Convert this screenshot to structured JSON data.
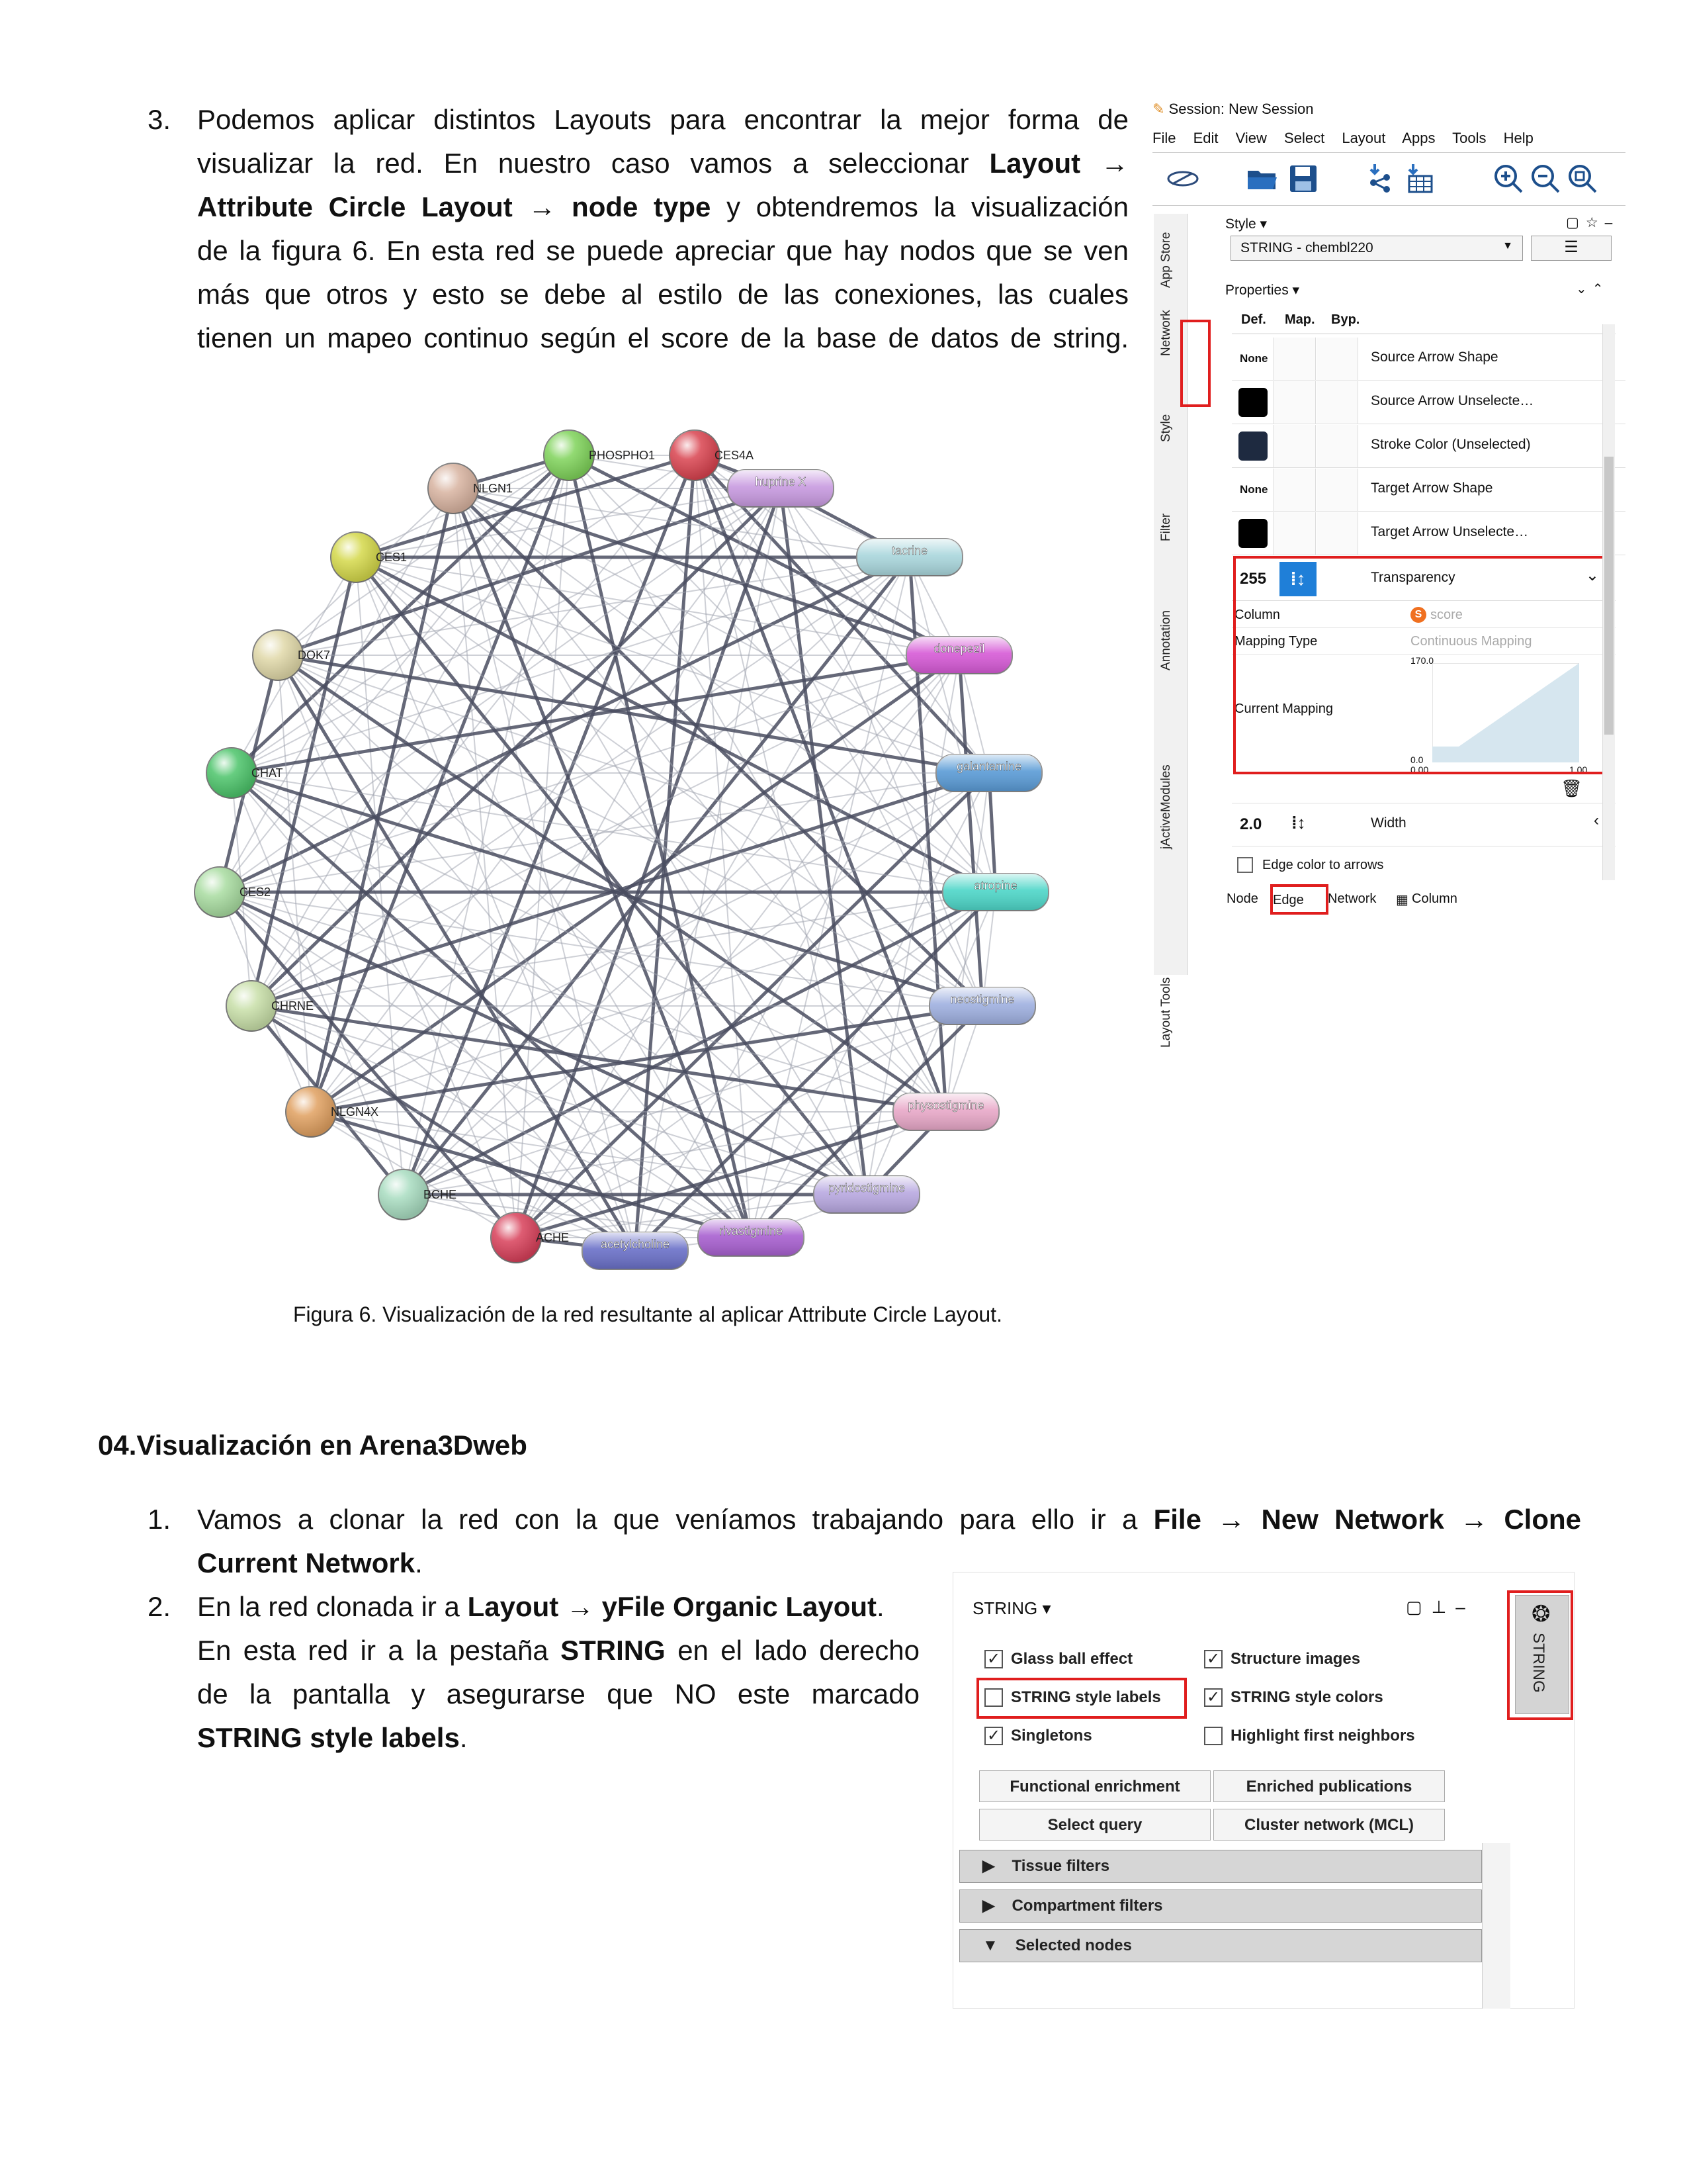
{
  "section3": {
    "number": "3.",
    "lines": [
      "Podemos aplicar distintos Layouts para encontrar la mejor forma de",
      "visualizar la red. En nuestro caso vamos a seleccionar",
      "Attribute Circle Layout",
      "node type",
      "y obtendremos la visualización",
      "de la figura 6. En esta red se puede apreciar que hay nodos que se ven",
      "más que otros y esto se debe al estilo de las conexiones, las cuales",
      "tienen un mapeo continuo según el score de la base de datos de string."
    ],
    "bold_layout": "Layout",
    "arrow": "→"
  },
  "figure": {
    "caption": "Figura 6. Visualización de la red resultante al aplicar Attribute Circle Layout.",
    "nodes": [
      {
        "label": "PHOSPHO1",
        "color": "#7fd35a",
        "shape": "ball"
      },
      {
        "label": "CES4A",
        "color": "#d9434f",
        "shape": "ball"
      },
      {
        "label": "huprine X",
        "color": "#c89ae0",
        "shape": "pill"
      },
      {
        "label": "NLGN1",
        "color": "#d8b3a0",
        "shape": "ball"
      },
      {
        "label": "tacrine",
        "color": "#a9d6dc",
        "shape": "pill"
      },
      {
        "label": "CES1",
        "color": "#d4d84a",
        "shape": "ball"
      },
      {
        "label": "donepezil",
        "color": "#d65ad6",
        "shape": "pill"
      },
      {
        "label": "DOK7",
        "color": "#e0d8a8",
        "shape": "ball"
      },
      {
        "label": "galantamine",
        "color": "#5a9bd6",
        "shape": "pill"
      },
      {
        "label": "CHAT",
        "color": "#4cc46a",
        "shape": "ball"
      },
      {
        "label": "atropine",
        "color": "#4dd6c8",
        "shape": "pill"
      },
      {
        "label": "CES2",
        "color": "#a8dca0",
        "shape": "ball"
      },
      {
        "label": "neostigmine",
        "color": "#9fb0e0",
        "shape": "pill"
      },
      {
        "label": "CHRNE",
        "color": "#c8dfa8",
        "shape": "ball"
      },
      {
        "label": "physostigmine",
        "color": "#e8a8c8",
        "shape": "pill"
      },
      {
        "label": "NLGN4X",
        "color": "#e0a060",
        "shape": "ball"
      },
      {
        "label": "pyridostigmine",
        "color": "#b8a8e0",
        "shape": "pill"
      },
      {
        "label": "BCHE",
        "color": "#a8dcc0",
        "shape": "ball"
      },
      {
        "label": "rivastigmine",
        "color": "#a860d0",
        "shape": "pill"
      },
      {
        "label": "ACHE",
        "color": "#d8405a",
        "shape": "ball"
      },
      {
        "label": "acetylcholine",
        "color": "#6a70c8",
        "shape": "pill"
      }
    ]
  },
  "cytoscape": {
    "session_title": "Session: New Session",
    "menu": [
      "File",
      "Edit",
      "View",
      "Select",
      "Layout",
      "Apps",
      "Tools",
      "Help"
    ],
    "side_tabs": [
      "App Store",
      "Network",
      "Style",
      "Filter",
      "Annotation",
      "jActiveModules",
      "Layout Tools"
    ],
    "style_label": "Style",
    "style_value": "STRING - chembl220",
    "properties_label": "Properties",
    "col_headers": [
      "Def.",
      "Map.",
      "Byp."
    ],
    "rows": [
      {
        "def": "None",
        "label": "Source Arrow Shape"
      },
      {
        "def": "",
        "label": "Source Arrow Unselecte…",
        "swatch": "#000000"
      },
      {
        "def": "",
        "label": "Stroke Color (Unselected)",
        "swatch": "#1e2a40"
      },
      {
        "def": "None",
        "label": "Target Arrow Shape"
      },
      {
        "def": "",
        "label": "Target Arrow Unselecte…",
        "swatch": "#000000"
      }
    ],
    "transparency": {
      "def": "255",
      "label": "Transparency",
      "column_label": "Column",
      "column_value": "score",
      "mapping_type_label": "Mapping Type",
      "mapping_type_value": "Continuous Mapping",
      "current_mapping_label": "Current Mapping",
      "y_max": "170.0",
      "y_min": "0.0",
      "x_min": "0.00",
      "x_max": "1.00"
    },
    "width_row": {
      "def": "2.0",
      "label": "Width"
    },
    "edge_color_label": "Edge color to arrows",
    "bottom_tabs": [
      "Node",
      "Edge",
      "Network",
      "Column"
    ]
  },
  "section04": {
    "heading": "04.Visualización en Arena3Dweb",
    "item1_number": "1.",
    "item1_text": "Vamos a clonar la red con la que veníamos trabajando para ello ir a",
    "item1_file": "File",
    "item1_new": "New Network",
    "item1_clone": "Clone",
    "item1_current": "Current Network",
    "item2_number": "2.",
    "item2_pre": "En la red clonada ir a",
    "item2_layout": "Layout",
    "item2_yfile": "yFile Organic Layout",
    "item2_l2a": "En esta red ir a la pestaña",
    "item2_string": "STRING",
    "item2_l2b": "en el lado derecho",
    "item2_l3": "de la pantalla y asegurarse que NO este marcado",
    "item2_l4": "STRING style labels"
  },
  "string_panel": {
    "title": "STRING",
    "side_tab": "STRING",
    "checks": [
      {
        "label": "Glass ball effect",
        "checked": true
      },
      {
        "label": "Structure images",
        "checked": true
      },
      {
        "label": "STRING style labels",
        "checked": false
      },
      {
        "label": "STRING style colors",
        "checked": true
      },
      {
        "label": "Singletons",
        "checked": true
      },
      {
        "label": "Highlight first neighbors",
        "checked": false
      }
    ],
    "buttons": [
      "Functional enrichment",
      "Enriched publications",
      "Select query",
      "Cluster network (MCL)"
    ],
    "sections": [
      "Tissue filters",
      "Compartment filters",
      "Selected nodes"
    ]
  }
}
